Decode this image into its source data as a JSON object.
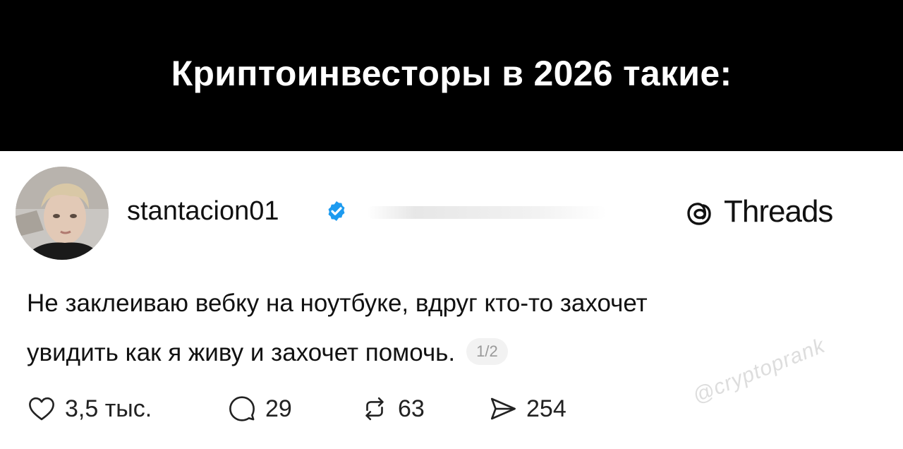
{
  "banner": {
    "title": "Криптоинвесторы в 2026 такие:"
  },
  "post": {
    "username": "stantacion01",
    "platform": "Threads",
    "text_line1": "Не заклеиваю вебку на ноутбуке, вдруг кто-то захочет",
    "text_line2": "увидить как я живу и захочет помочь.",
    "page_indicator": "1/2",
    "actions": {
      "likes": "3,5 тыс.",
      "replies": "29",
      "reposts": "63",
      "shares": "254"
    }
  },
  "watermark": "@cryptoprank",
  "colors": {
    "banner_bg": "#000000",
    "verified_blue": "#1d9bf0",
    "text": "#111111"
  }
}
